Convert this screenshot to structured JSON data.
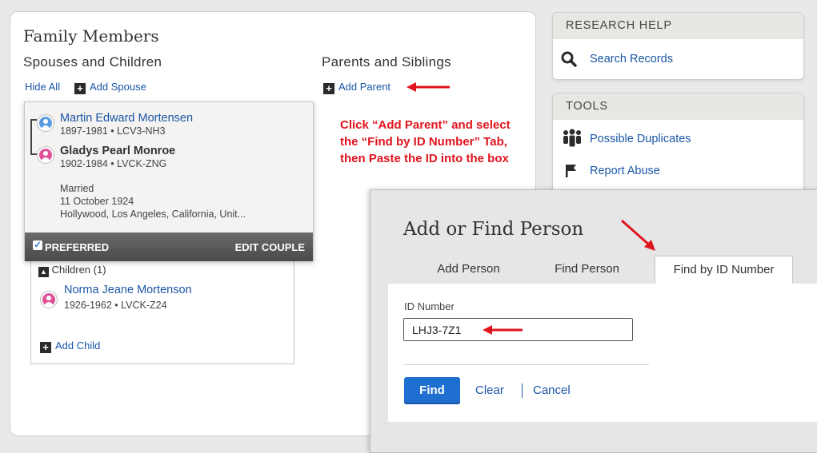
{
  "family": {
    "title": "Family Members",
    "spouses_heading": "Spouses and Children",
    "parents_heading": "Parents and Siblings",
    "hide_all": "Hide All",
    "add_spouse": "Add Spouse",
    "add_parent": "Add Parent",
    "couple": {
      "husband": {
        "name": "Martin Edward Mortensen",
        "meta": "1897-1981 • LCV3-NH3"
      },
      "wife": {
        "name": "Gladys Pearl Monroe",
        "meta": "1902-1984 • LVCK-ZNG"
      },
      "event": "Married",
      "date": "11 October 1924",
      "place": "Hollywood, Los Angeles, California, Unit...",
      "preferred": "PREFERRED",
      "edit_couple": "EDIT COUPLE"
    },
    "children": {
      "label": "Children",
      "count": "(1)",
      "items": [
        {
          "name": "Norma Jeane Mortenson",
          "meta": "1926-1962 • LVCK-Z24"
        }
      ],
      "add_child": "Add Child"
    }
  },
  "annotation": {
    "line1": "Click “Add Parent” and select",
    "line2": "the “Find by ID Number” Tab,",
    "line3": "then Paste the ID into the box"
  },
  "research_help": {
    "title": "RESEARCH HELP",
    "search_records": "Search Records"
  },
  "tools": {
    "title": "TOOLS",
    "possible_duplicates": "Possible Duplicates",
    "report_abuse": "Report Abuse"
  },
  "dialog": {
    "title": "Add or Find Person",
    "tabs": [
      "Add Person",
      "Find Person",
      "Find by ID Number"
    ],
    "active_tab": "Find by ID Number",
    "id_label": "ID Number",
    "id_value": "LHJ3-7Z1",
    "find": "Find",
    "clear": "Clear",
    "cancel": "Cancel"
  },
  "colors": {
    "link": "#1a56a7",
    "annotation": "#e0141e",
    "primary_button": "#1f6fd1",
    "male": "#5b9be0",
    "female": "#e05297"
  }
}
